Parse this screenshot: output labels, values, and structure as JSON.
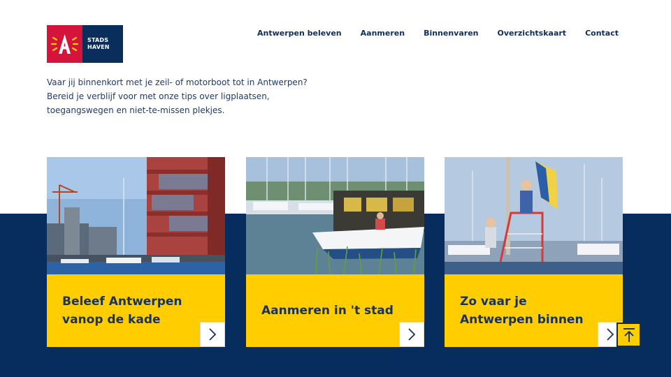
{
  "brand": {
    "logo_text_line1": "STADS",
    "logo_text_line2": "HAVEN",
    "red": "#d4143a",
    "navy": "#072c5e",
    "yellow": "#ffcd00"
  },
  "nav": {
    "items": [
      {
        "label": "Antwerpen beleven"
      },
      {
        "label": "Aanmeren"
      },
      {
        "label": "Binnenvaren"
      },
      {
        "label": "Overzichtskaart"
      },
      {
        "label": "Contact"
      }
    ]
  },
  "intro": {
    "line1": "Vaar jij binnenkort met je zeil- of motorboot tot in Antwerpen?",
    "line2": "Bereid je verblijf voor met onze tips over ligplaatsen,",
    "line3": "toegangswegen en niet-te-missen plekjes."
  },
  "cards": [
    {
      "title_line1": "Beleef Antwerpen",
      "title_line2": "vanop de kade",
      "icon": "chevron-right-icon"
    },
    {
      "title_line1": "Aanmeren in 't stad",
      "title_line2": "",
      "icon": "chevron-right-icon"
    },
    {
      "title_line1": "Zo vaar je",
      "title_line2": "Antwerpen binnen",
      "icon": "chevron-right-icon"
    }
  ],
  "back_to_top": {
    "icon": "arrow-up-to-top-icon"
  }
}
